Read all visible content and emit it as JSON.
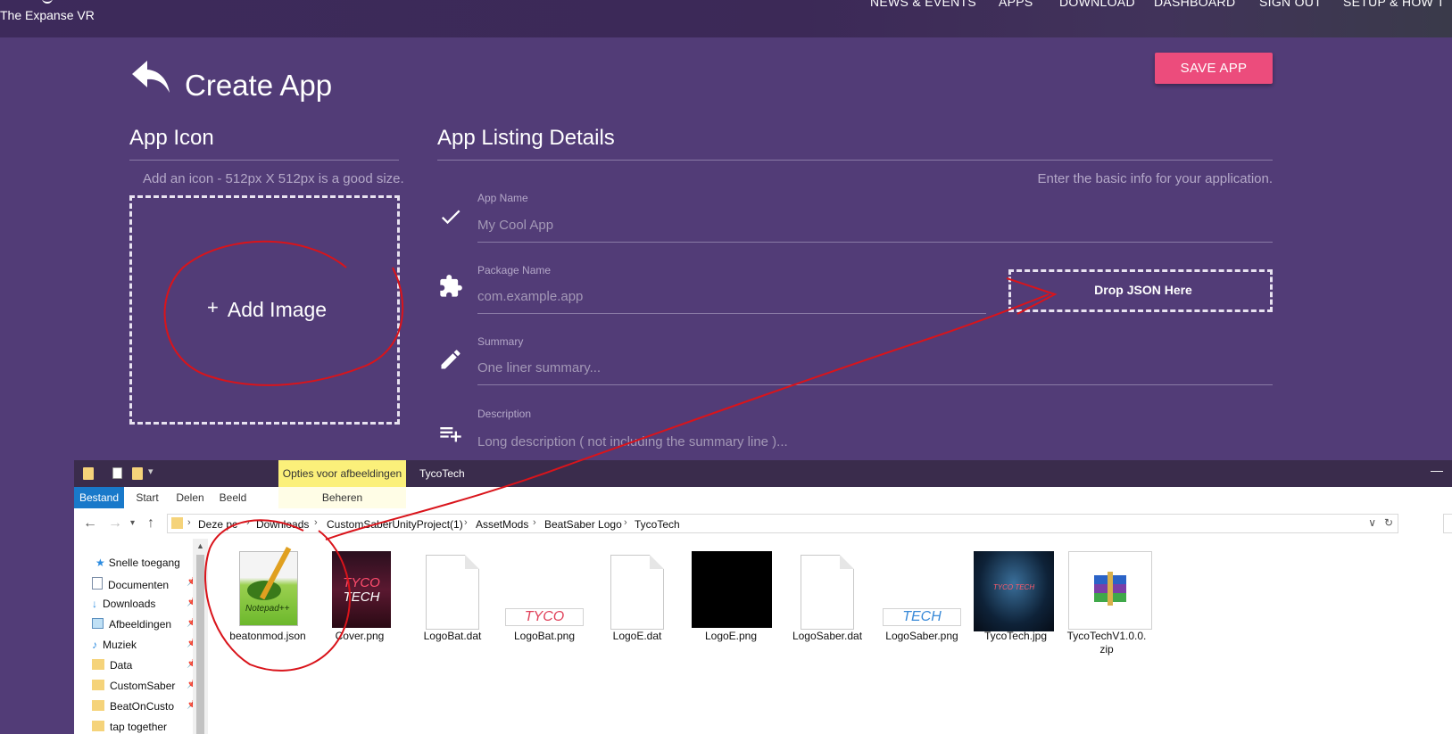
{
  "nav": {
    "brand": "The Expanse VR",
    "links": [
      "NEWS & EVENTS",
      "APPS",
      "DOWNLOAD",
      "DASHBOARD",
      "SIGN OUT",
      "SETUP & HOW T"
    ]
  },
  "page": {
    "title": "Create App",
    "save_label": "SAVE APP"
  },
  "app_icon": {
    "title": "App Icon",
    "hint": "Add an icon - 512px X 512px is a good size.",
    "add_label": "Add Image"
  },
  "listing": {
    "title": "App Listing Details",
    "hint": "Enter the basic info for your application.",
    "fields": [
      {
        "label": "App Name",
        "placeholder": "My Cool App",
        "icon": "check-icon"
      },
      {
        "label": "Package Name",
        "placeholder": "com.example.app",
        "icon": "puzzle-icon"
      },
      {
        "label": "Summary",
        "placeholder": "One liner summary...",
        "icon": "pencil-icon"
      },
      {
        "label": "Description",
        "placeholder": "Long description ( not including the summary line )...",
        "icon": "playlist-add-icon"
      }
    ],
    "json_drop": "Drop JSON Here"
  },
  "explorer": {
    "context_tab": "Opties voor afbeeldingen",
    "window_title": "TycoTech",
    "ribbon_tabs": [
      "Bestand",
      "Start",
      "Delen",
      "Beeld",
      "Beheren"
    ],
    "breadcrumb": [
      "Deze pc",
      "Downloads",
      "CustomSaberUnityProject(1)",
      "AssetMods",
      "BeatSaber Logo",
      "TycoTech"
    ],
    "sidebar": {
      "quick_access": "Snelle toegang",
      "items": [
        "Documenten",
        "Downloads",
        "Afbeeldingen",
        "Muziek",
        "Data",
        "CustomSaber",
        "BeatOnCusto",
        "tap together"
      ]
    },
    "files": [
      "beatonmod.json",
      "Cover.png",
      "LogoBat.dat",
      "LogoBat.png",
      "LogoE.dat",
      "LogoE.png",
      "LogoSaber.dat",
      "LogoSaber.png",
      "TycoTech.jpg",
      "TycoTechV1.0.0.zip"
    ],
    "thumb_text": {
      "cover_line1": "TYCO",
      "cover_line2": "TECH",
      "logobat": "TYCO",
      "logosaber": "TECH",
      "tycotech_jpg": "TYCO TECH",
      "notepad": "Notepad++"
    }
  },
  "colors": {
    "page_bg": "#523c77",
    "accent": "#ec4c7c",
    "annotation": "#d9141b",
    "explorer_tab_active": "#1979ca"
  }
}
